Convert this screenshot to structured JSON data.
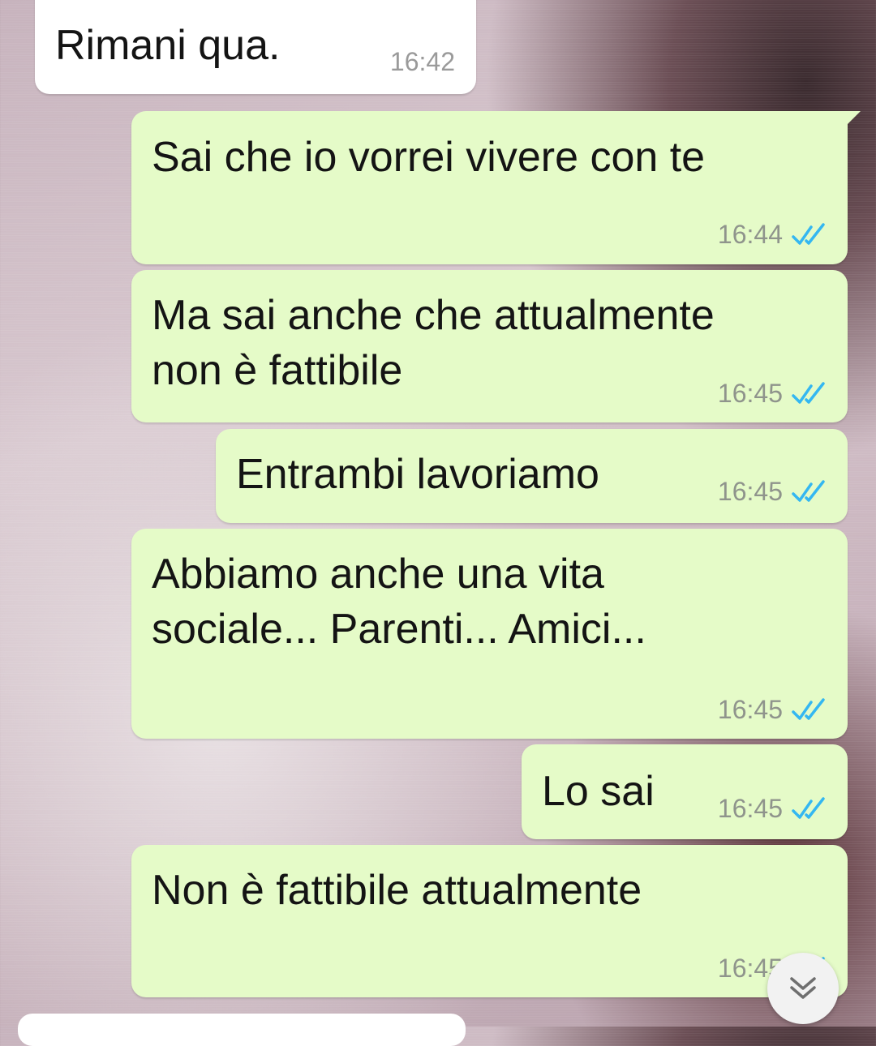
{
  "messages": [
    {
      "text": "Rimani qua.",
      "time": "16:42",
      "direction": "incoming"
    },
    {
      "text": "Sai che io vorrei vivere con te",
      "time": "16:44",
      "direction": "outgoing",
      "status": "read"
    },
    {
      "text": "Ma sai anche che attualmente\nnon è fattibile",
      "time": "16:45",
      "direction": "outgoing",
      "status": "read"
    },
    {
      "text": "Entrambi lavoriamo",
      "time": "16:45",
      "direction": "outgoing",
      "status": "read"
    },
    {
      "text": "Abbiamo anche una vita\nsociale... Parenti... Amici...",
      "time": "16:45",
      "direction": "outgoing",
      "status": "read"
    },
    {
      "text": "Lo sai",
      "time": "16:45",
      "direction": "outgoing",
      "status": "read"
    },
    {
      "text": "Non è fattibile attualmente",
      "time": "16:45",
      "direction": "outgoing",
      "status": "read"
    }
  ],
  "colors": {
    "incoming_bubble": "#ffffff",
    "outgoing_bubble": "#e5fbc8",
    "read_ticks": "#34b7f1",
    "timestamp": "#8f948c"
  },
  "icons": {
    "read_status": "double-check-icon",
    "scroll_down": "chevron-double-down-icon"
  }
}
